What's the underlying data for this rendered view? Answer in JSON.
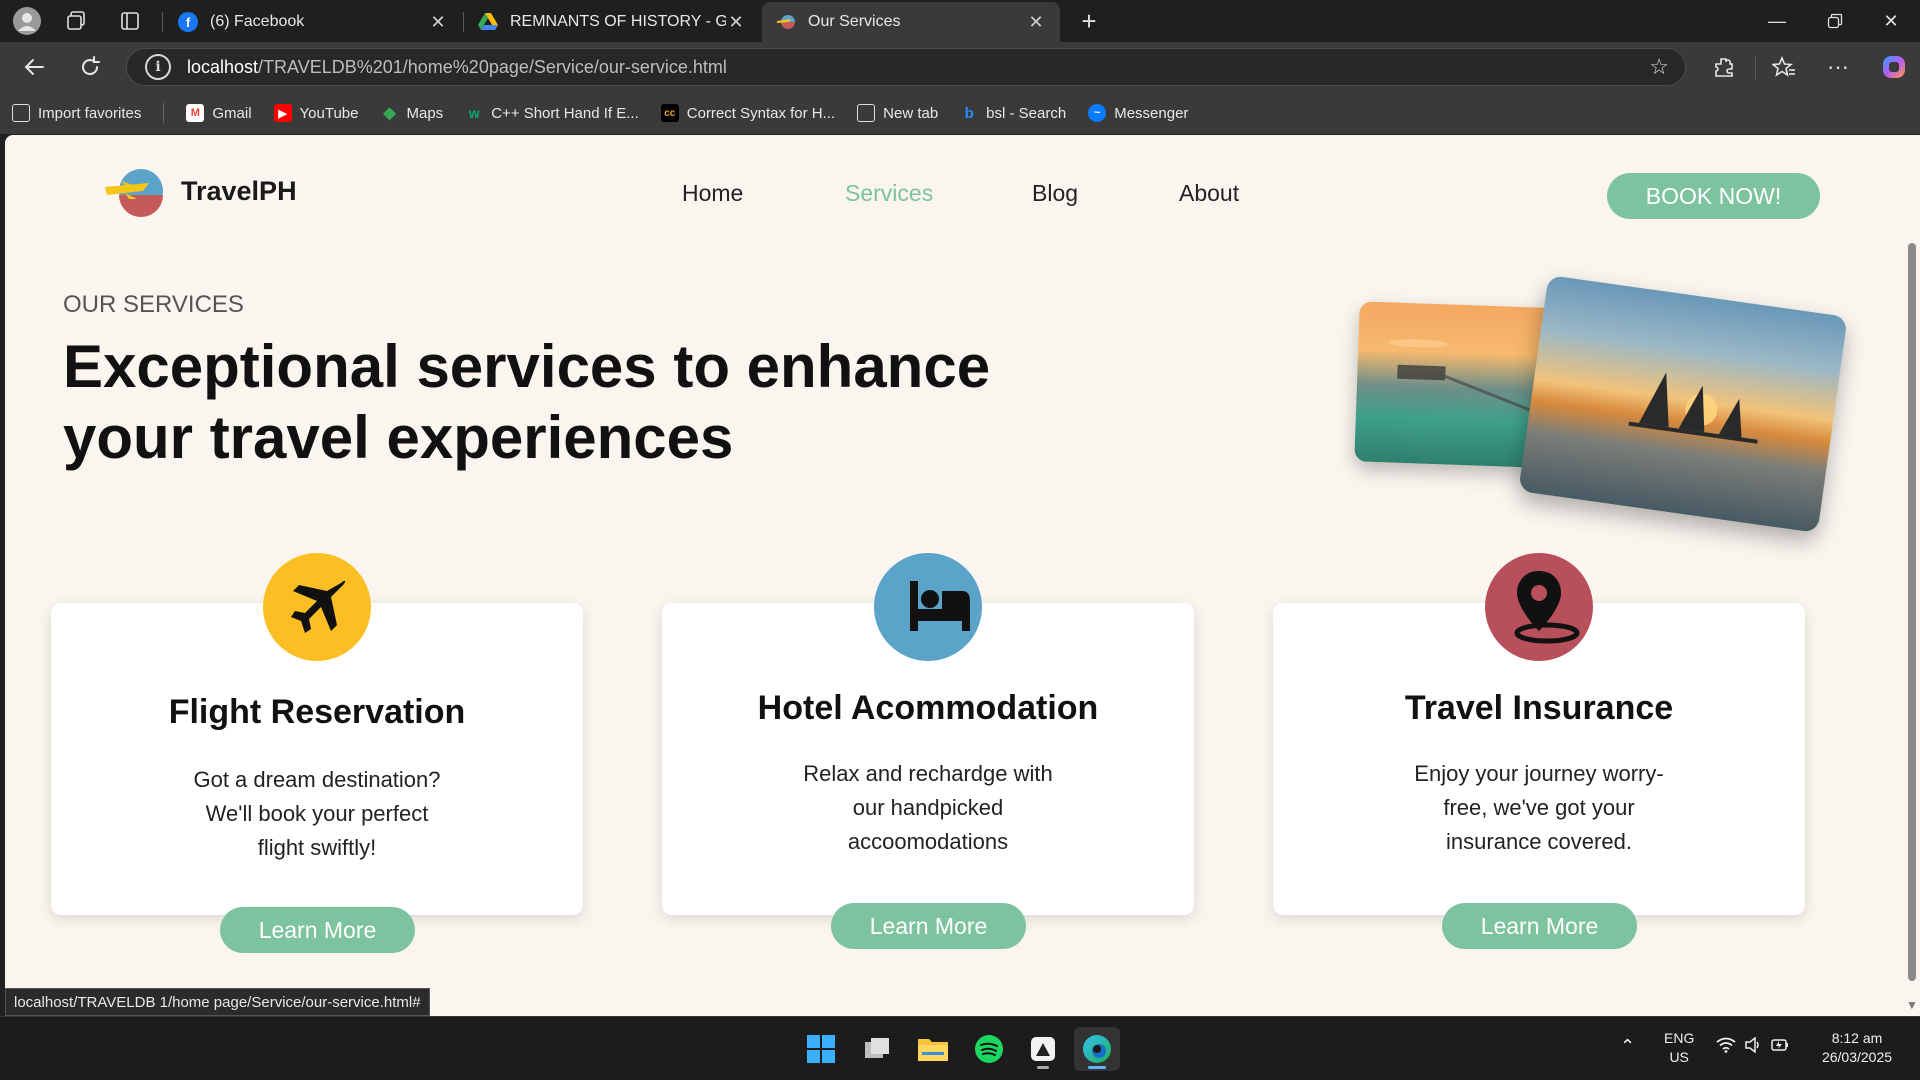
{
  "browser": {
    "tabs": [
      {
        "label": "(6) Facebook",
        "icon": "facebook-icon"
      },
      {
        "label": "REMNANTS OF HISTORY - Google Drive",
        "icon": "google-drive-icon"
      },
      {
        "label": "Our Services",
        "icon": "travelph-icon"
      }
    ],
    "url_host": "localhost",
    "url_path": "/TRAVELDB%201/home%20page/Service/our-service.html",
    "bookmarks": [
      {
        "label": "Import favorites",
        "icon": "import-icon"
      },
      {
        "label": "Gmail",
        "icon": "gmail-icon"
      },
      {
        "label": "YouTube",
        "icon": "youtube-icon"
      },
      {
        "label": "Maps",
        "icon": "maps-icon"
      },
      {
        "label": "C++ Short Hand If E...",
        "icon": "w3schools-icon"
      },
      {
        "label": "Correct Syntax for H...",
        "icon": "cc-icon"
      },
      {
        "label": "New tab",
        "icon": "newtab-icon"
      },
      {
        "label": "bsl - Search",
        "icon": "bing-icon"
      },
      {
        "label": "Messenger",
        "icon": "messenger-icon"
      }
    ],
    "status_url": "localhost/TRAVELDB 1/home page/Service/our-service.html#"
  },
  "site": {
    "brand": "TravelPH",
    "nav": [
      {
        "label": "Home",
        "active": false
      },
      {
        "label": "Services",
        "active": true
      },
      {
        "label": "Blog",
        "active": false
      },
      {
        "label": "About",
        "active": false
      }
    ],
    "cta": "BOOK NOW!",
    "accent_color": "#7ec39f"
  },
  "hero": {
    "eyebrow": "OUR SERVICES",
    "headline": "Exceptional services to enhance your travel experiences"
  },
  "services": [
    {
      "title": "Flight Reservation",
      "description": "Got a dream destination? We'll book your perfect flight swiftly!",
      "button": "Learn More",
      "icon": "airplane-icon",
      "icon_color": "#fbbf24"
    },
    {
      "title": "Hotel Acommodation",
      "description": "Relax and rechardge with our handpicked accoomodations",
      "button": "Learn More",
      "icon": "bed-icon",
      "icon_color": "#5ba3c9"
    },
    {
      "title": "Travel Insurance",
      "description": "Enjoy your journey worry-free, we've got your insurance covered.",
      "button": "Learn More",
      "icon": "location-pin-icon",
      "icon_color": "#b7505a"
    }
  ],
  "taskbar": {
    "lang": "ENG",
    "region": "US",
    "time": "8:12 am",
    "date": "26/03/2025"
  }
}
